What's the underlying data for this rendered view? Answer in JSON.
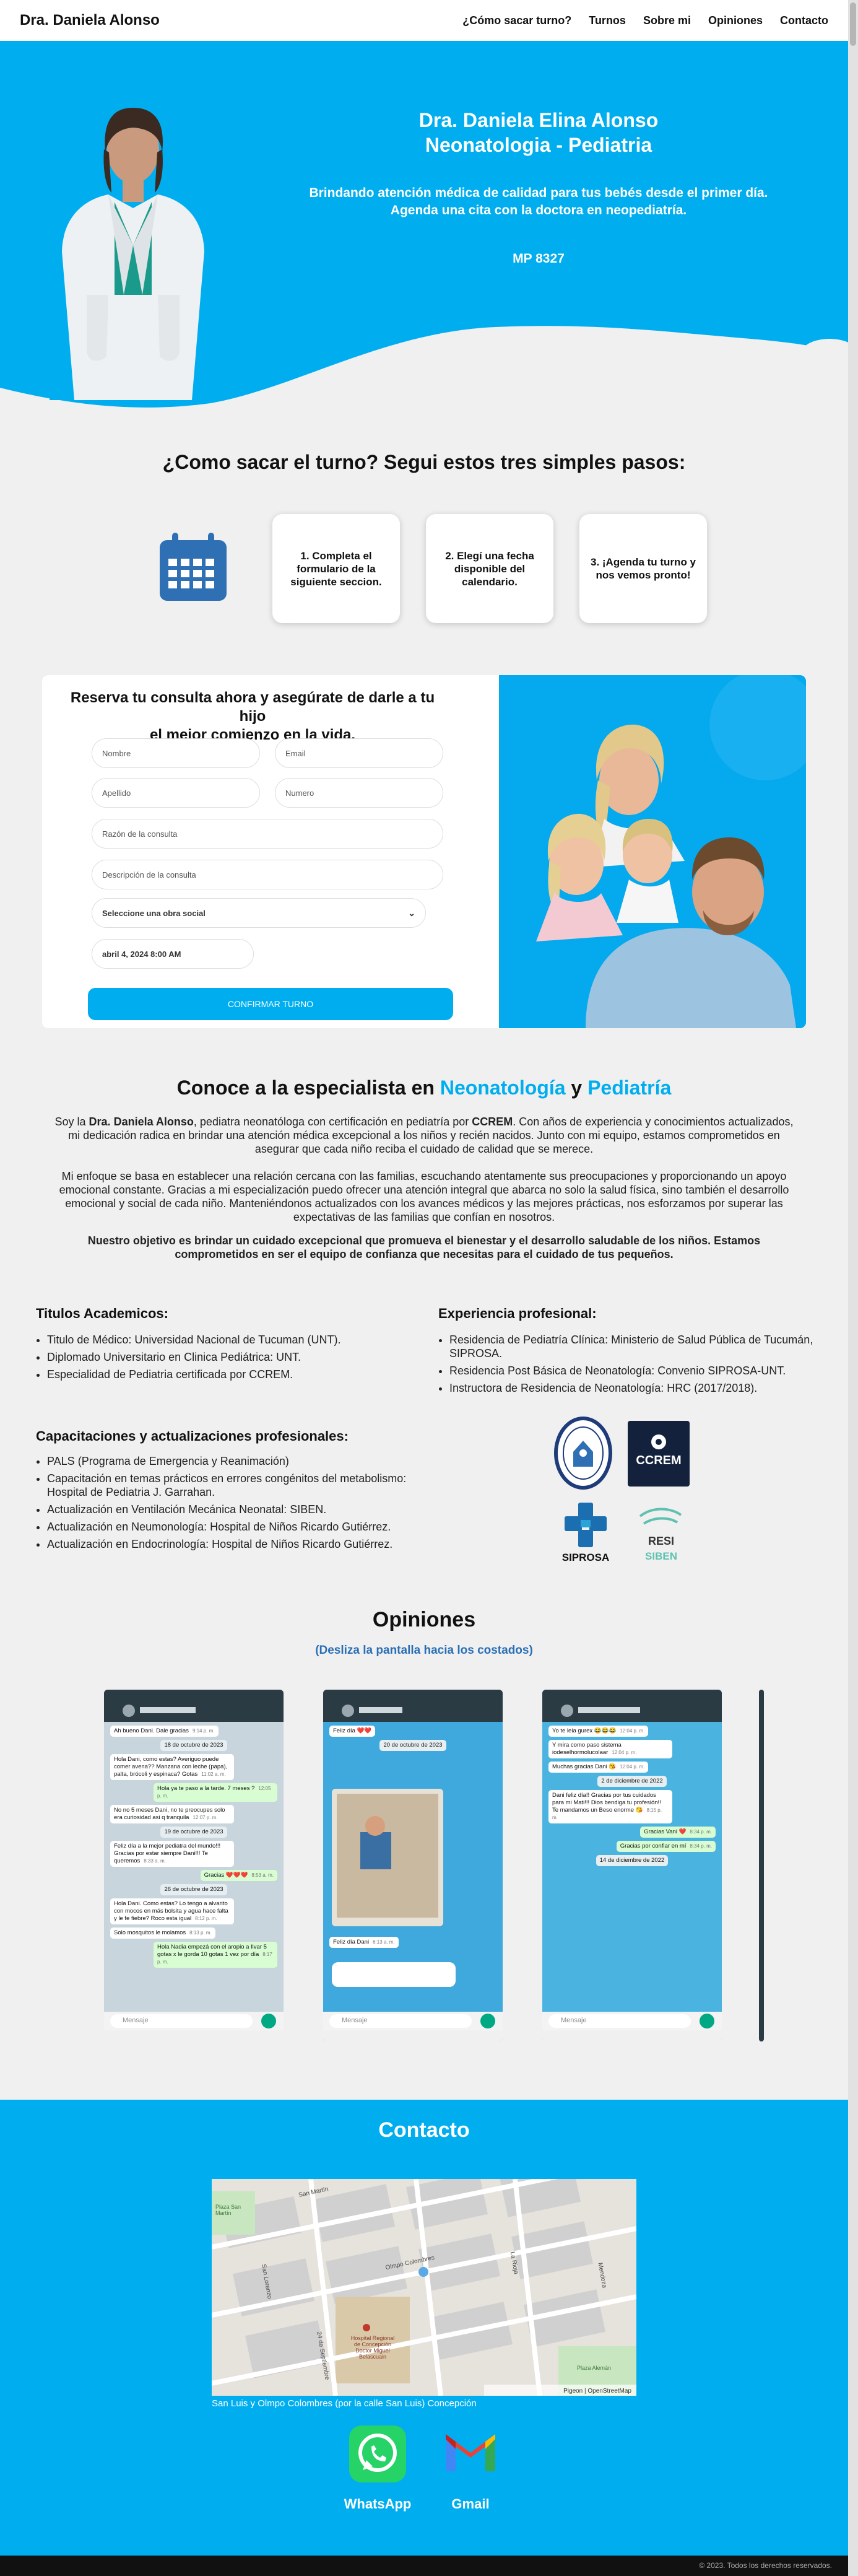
{
  "navbar": {
    "brand": "Dra. Daniela Alonso",
    "links": [
      "¿Cómo sacar turno?",
      "Turnos",
      "Sobre mi",
      "Opiniones",
      "Contacto"
    ]
  },
  "hero": {
    "title_line1": "Dra. Daniela Elina Alonso",
    "title_line2": "Neonatologia - Pediatria",
    "sub_line1": "Brindando atención médica de calidad para tus bebés desde el primer día.",
    "sub_line2": "Agenda una cita con la doctora en neopediatría.",
    "mp": "MP 8327"
  },
  "steps": {
    "title": "¿Como sacar el turno? Segui estos tres simples pasos:",
    "cards": [
      "1. Completa el formulario de la siguiente seccion.",
      "2. Elegí una fecha disponible del calendario.",
      "3. ¡Agenda tu turno y nos vemos pronto!"
    ]
  },
  "booking": {
    "title_line1": "Reserva tu consulta ahora y asegúrate de darle a tu hijo",
    "title_line2": "el mejor comienzo en la vida.",
    "placeholders": {
      "nombre": "Nombre",
      "email": "Email",
      "apellido": "Apellido",
      "numero": "Numero",
      "razon": "Razón de la consulta",
      "descripcion": "Descripción de la consulta"
    },
    "obra_social": "Seleccione una obra social",
    "date": "abril 4, 2024 8:00 AM",
    "confirm": "CONFIRMAR TURNO"
  },
  "about": {
    "title_pre": "Conoce a la especialista en ",
    "title_hl1": "Neonatología",
    "title_mid": " y ",
    "title_hl2": "Pediatría",
    "p1_a": "Soy la ",
    "p1_name": "Dra. Daniela Alonso",
    "p1_b": ", pediatra neonatóloga con certificación en pediatría por ",
    "p1_org": "CCREM",
    "p1_c": ". Con años de experiencia y conocimientos actualizados, mi dedicación radica en brindar una atención médica excepcional a los niños y recién nacidos. Junto con mi equipo, estamos comprometidos en asegurar que cada niño reciba el cuidado de calidad que se merece.",
    "p2": "Mi enfoque se basa en establecer una relación cercana con las familias, escuchando atentamente sus preocupaciones y proporcionando un apoyo emocional constante. Gracias a mi especialización puedo ofrecer una atención integral que abarca no solo la salud física, sino también el desarrollo emocional y social de cada niño. Manteniéndonos actualizados con los avances médicos y las mejores prácticas, nos esforzamos por superar las expectativas de las familias que confían en nosotros.",
    "p3": "Nuestro objetivo es brindar un cuidado excepcional que promueva el bienestar y el desarrollo saludable de los niños. Estamos comprometidos en ser el equipo de confianza que necesitas para el cuidado de tus pequeños."
  },
  "academic": {
    "title": "Titulos Academicos:",
    "items": [
      "Titulo de Médico: Universidad Nacional de Tucuman (UNT).",
      "Diplomado Universitario en Clinica Pediátrica: UNT.",
      "Especialidad de Pediatria certificada por CCREM."
    ]
  },
  "experience": {
    "title": "Experiencia profesional:",
    "items": [
      "Residencia de Pediatría Clínica: Ministerio de Salud Pública de Tucumán, SIPROSA.",
      "Residencia Post Básica de Neonatología: Convenio SIPROSA-UNT.",
      "Instructora de Residencia de Neonatología: HRC (2017/2018)."
    ]
  },
  "training": {
    "title": "Capacitaciones y actualizaciones profesionales:",
    "items": [
      "PALS (Programa de Emergencia y Reanimación)",
      "Capacitación en temas prácticos en errores congénitos del metabolismo: Hospital de Pediatria J. Garrahan.",
      "Actualización en Ventilación Mecánica Neonatal: SIBEN.",
      "Actualización en Neumonología: Hospital de Niños Ricardo Gutiérrez.",
      "Actualización en Endocrinología: Hospital de Niños Ricardo Gutiérrez."
    ]
  },
  "logos": {
    "ccrem": "CCREM",
    "siprosa": "SIPROSA",
    "resi": "RESI",
    "siben": "SIBEN"
  },
  "opinions": {
    "title": "Opiniones",
    "subtitle": "(Desliza la pantalla hacia los costados)",
    "input_placeholder": "Mensaje",
    "phone1": [
      {
        "text": "Ah bueno Dani. Dale gracias",
        "time": "9:14 p. m.",
        "out": false
      },
      {
        "text": "18 de octubre de 2023",
        "date": true
      },
      {
        "text": "Hola Dani, como estas? Averiguo puede comer avena?? Manzana con leche (papa), palta, brócoli y espinaca? Gotas",
        "time": "11:02 a. m.",
        "out": false
      },
      {
        "text": "Hola ya te paso a la tarde. 7 meses ?",
        "time": "12:05 p. m.",
        "out": true
      },
      {
        "text": "No no 5 meses Dani, no te preocupes solo era curiosidad asi q tranquila",
        "time": "12:07 p. m.",
        "out": false
      },
      {
        "text": "19 de octubre de 2023",
        "date": true
      },
      {
        "text": "Feliz día a la mejor pediatra del mundo!!! Gracias por estar siempre Dani!!! Te queremos",
        "time": "8:33 a. m.",
        "out": false
      },
      {
        "text": "Gracias ❤️❤️❤️",
        "time": "8:53 a. m.",
        "out": true
      },
      {
        "text": "26 de octubre de 2023",
        "date": true
      },
      {
        "text": "Hola Dani. Como estas? Lo tengo a alvarito con mocos en más bolsita y agua hace falta y le fe fiebre? Roco esta igual",
        "time": "8:12 p. m.",
        "out": false
      },
      {
        "text": "Solo mosquitos le molamos",
        "time": "8:13 p. m.",
        "out": false
      },
      {
        "text": "Hola Nadia empezá con el aropio a Ilvar 5 gotas x le gorda 10 gotas 1 vez por día",
        "time": "8:17 p. m.",
        "out": true
      }
    ],
    "phone2": [
      {
        "text": "Feliz día ❤️❤️",
        "time": "",
        "out": false
      },
      {
        "text": "20 de octubre de 2023",
        "date": true
      },
      {
        "text": "Feliz día Dani",
        "time": "6:13 a. m.",
        "out": false
      }
    ],
    "phone3": [
      {
        "text": "Yo te leia gurex 😂😂😂",
        "time": "12:04 p. m.",
        "out": false
      },
      {
        "text": "Y mira como paso sistema iodeselhormolucolaar",
        "time": "12:04 p. m.",
        "out": false
      },
      {
        "text": "Muchas gracias Dani 😘",
        "time": "12:04 p. m.",
        "out": false
      },
      {
        "text": "2 de diciembre de 2022",
        "date": true
      },
      {
        "text": "Dani feliz día!! Gracias por tus cuidados para mi Mati!!! Dios bendiga tu profesión!! Te mandamos un Beso enorme 😘",
        "time": "8:15 p. m.",
        "out": false
      },
      {
        "text": "Gracias Vani ❤️",
        "time": "8:34 p. m.",
        "out": true
      },
      {
        "text": "Gracias por confiar en mí",
        "time": "8:34 p. m.",
        "out": true
      },
      {
        "text": "14 de diciembre de 2022",
        "date": true
      }
    ]
  },
  "contact": {
    "title": "Contacto",
    "address": "San Luis y Olmpo Colombres (por la calle San Luis) Concepción",
    "whatsapp": "WhatsApp",
    "gmail": "Gmail",
    "map_labels": {
      "street1": "San Martín",
      "street2": "Olmpo Colombres",
      "street3": "San Lorenzo",
      "street4": "La Rioja",
      "street5": "Mendoza",
      "street6": "24 de Septiembre",
      "place1": "Plaza San Martín",
      "place2": "Plaza Alemán",
      "place3": "Hospital Regional de Concepción Doctor Miguel Belascuain",
      "attribution": "Pigeon | OpenStreetMap"
    }
  },
  "footer": {
    "text": "© 2023. Todos los derechos reservados."
  },
  "colors": {
    "accent": "#00aef0",
    "nav_text": "#111111",
    "link_blue": "#2a6fb6"
  }
}
